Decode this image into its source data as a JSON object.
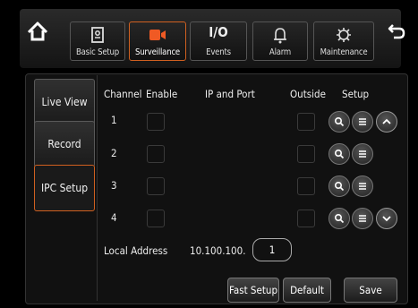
{
  "topbar": {
    "tabs": [
      {
        "label": "Basic Setup",
        "icon": "basic-setup-icon",
        "active": false
      },
      {
        "label": "Surveillance",
        "icon": "camera-icon",
        "active": true
      },
      {
        "label": "Events",
        "icon_text": "I/O",
        "active": false
      },
      {
        "label": "Alarm",
        "icon": "bell-icon",
        "active": false
      },
      {
        "label": "Maintenance",
        "icon": "wrench-icon",
        "active": false
      }
    ],
    "accent_color": "#d06020",
    "camera_icon_color": "#f05a24"
  },
  "sidebar": {
    "items": [
      {
        "label": "Live View"
      },
      {
        "label": "Record"
      },
      {
        "label": "IPC Setup"
      }
    ]
  },
  "table": {
    "headers": [
      "Channel",
      "Enable",
      "IP and Port",
      "Outside",
      "Setup"
    ],
    "rows": [
      {
        "channel": "1"
      },
      {
        "channel": "2"
      },
      {
        "channel": "3"
      },
      {
        "channel": "4"
      }
    ]
  },
  "local_address": {
    "label": "Local Address",
    "prefix": "10.100.100.",
    "value": "1"
  },
  "buttons": {
    "fast_setup": "Fast Setup",
    "default": "Default",
    "save": "Save"
  }
}
